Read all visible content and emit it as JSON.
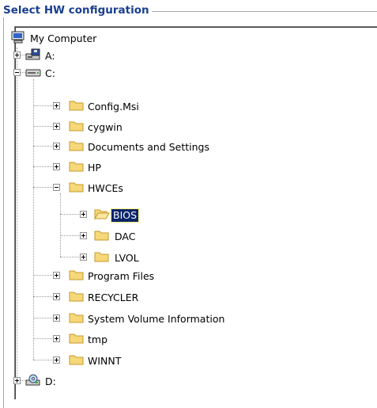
{
  "group": {
    "title": "Select HW configuration"
  },
  "tree": {
    "root": "My Computer",
    "drive_a": "A:",
    "drive_c": "C:",
    "config_msi": "Config.Msi",
    "cygwin": "cygwin",
    "documents_and_settings": "Documents and Settings",
    "hp": "HP",
    "hwces": "HWCEs",
    "bios": "BIOS",
    "dac": "DAC",
    "lvol": "LVOL",
    "program_files": "Program Files",
    "recycler": "RECYCLER",
    "system_volume_information": "System Volume Information",
    "tmp": "tmp",
    "winnt": "WINNT",
    "drive_d": "D:"
  },
  "colors": {
    "title": "#1a3f8f",
    "folder": "#f6d87a",
    "folder_edge": "#c49a2a",
    "selection": "#0a246a"
  },
  "icons": {
    "root": "computer-icon",
    "a": "floppy-drive-icon",
    "c": "hard-drive-icon",
    "d": "cd-drive-icon",
    "folder": "folder-icon",
    "open_folder": "open-folder-icon"
  }
}
